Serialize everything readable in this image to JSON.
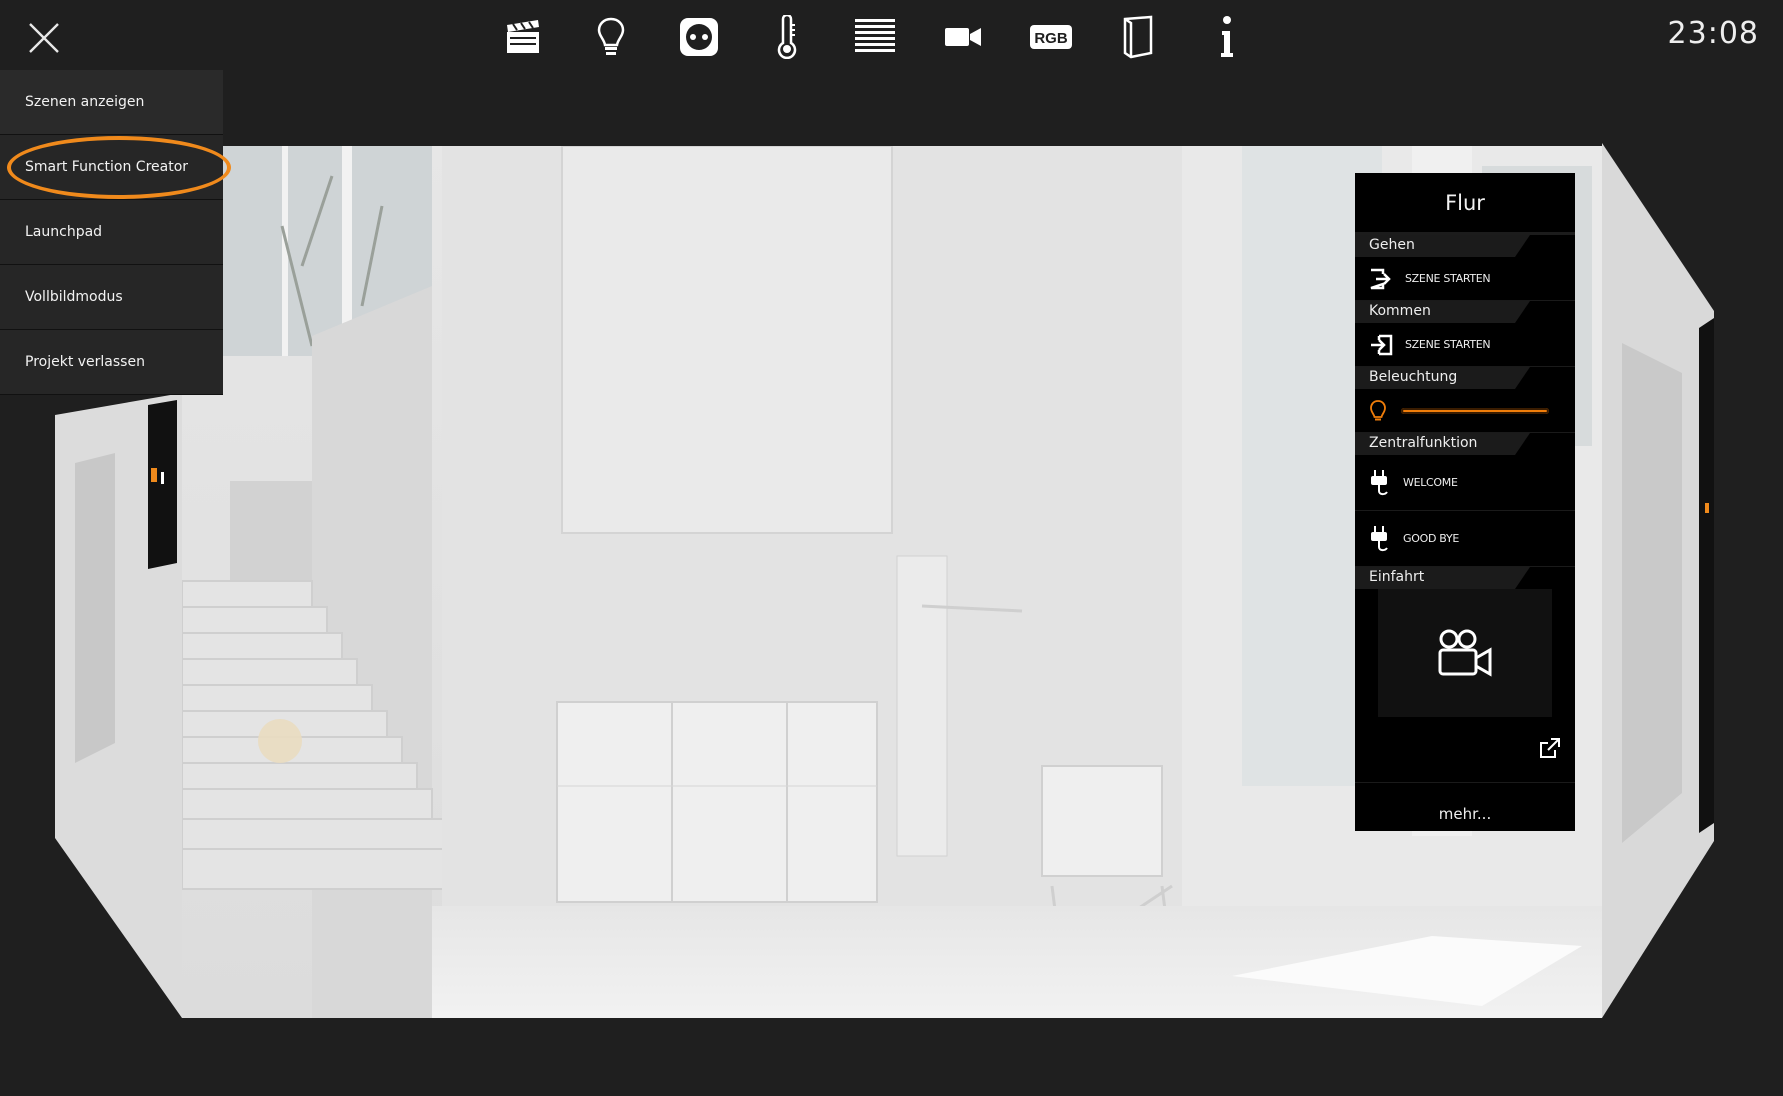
{
  "topbar": {
    "clock": "23:08",
    "toolbar_icons": [
      "scenes-icon",
      "lightbulb-icon",
      "socket-icon",
      "thermometer-icon",
      "blinds-icon",
      "camera-icon",
      "rgb-icon",
      "door-icon",
      "info-icon"
    ],
    "rgb_text": "RGB"
  },
  "menu": {
    "items": [
      {
        "label": "Szenen anzeigen"
      },
      {
        "label": "Smart Function Creator"
      },
      {
        "label": "Launchpad"
      },
      {
        "label": "Vollbildmodus"
      },
      {
        "label": "Projekt verlassen"
      }
    ],
    "highlight_color": "#f08a1c"
  },
  "panel": {
    "title": "Flur",
    "sections": {
      "gehen": {
        "label": "Gehen",
        "action": "SZENE STARTEN"
      },
      "kommen": {
        "label": "Kommen",
        "action": "SZENE STARTEN"
      },
      "beleuchtung": {
        "label": "Beleuchtung",
        "level_percent": 100
      },
      "zentral": {
        "label": "Zentralfunktion",
        "welcome": "WELCOME",
        "goodbye": "GOOD BYE"
      },
      "einfahrt": {
        "label": "Einfahrt"
      }
    },
    "more_label": "mehr...",
    "accent": "#f07d0a"
  }
}
